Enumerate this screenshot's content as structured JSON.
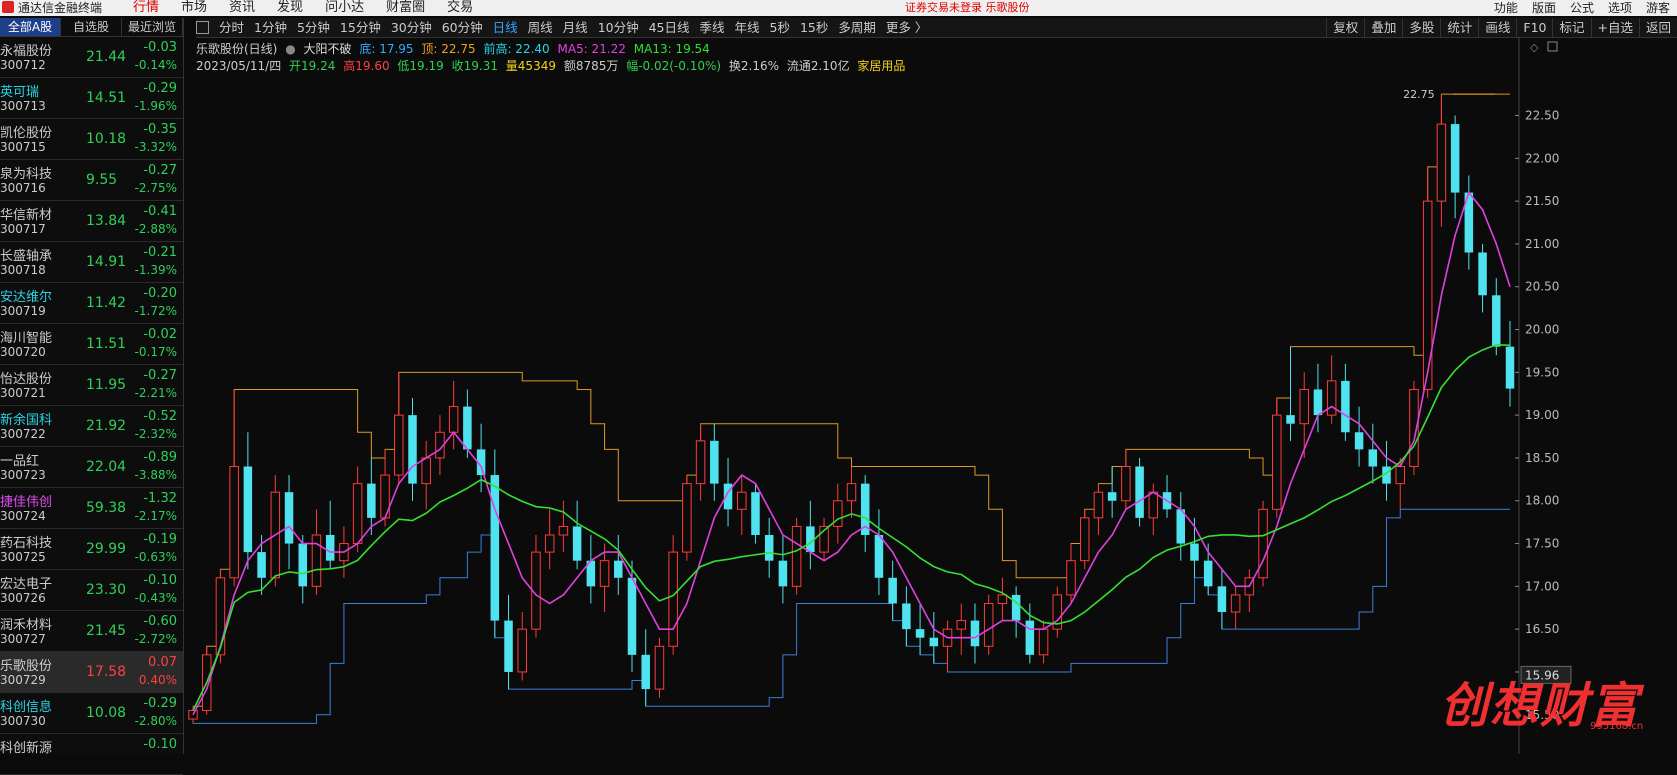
{
  "topbar": {
    "app_name": "通达信金融终端",
    "menu": [
      "行情",
      "市场",
      "资讯",
      "发现",
      "问小达",
      "财富圈",
      "交易"
    ],
    "notice": "证券交易未登录  乐歌股份",
    "right": [
      "功能",
      "版面",
      "公式",
      "选项",
      "游客"
    ]
  },
  "sidebar": {
    "tabs": [
      "全部A股",
      "自选股",
      "最近浏览"
    ],
    "stocks": [
      {
        "name": "永福股份",
        "code": "300712",
        "price": "21.44",
        "change": "-0.03",
        "pct": "-0.14%",
        "color": "normal"
      },
      {
        "name": "英可瑞",
        "code": "300713",
        "price": "14.51",
        "change": "-0.29",
        "pct": "-1.96%",
        "color": "cyan"
      },
      {
        "name": "凯伦股份",
        "code": "300715",
        "price": "10.18",
        "change": "-0.35",
        "pct": "-3.32%",
        "color": "normal"
      },
      {
        "name": "泉为科技",
        "code": "300716",
        "price": "9.55",
        "change": "-0.27",
        "pct": "-2.75%",
        "color": "normal"
      },
      {
        "name": "华信新材",
        "code": "300717",
        "price": "13.84",
        "change": "-0.41",
        "pct": "-2.88%",
        "color": "normal"
      },
      {
        "name": "长盛轴承",
        "code": "300718",
        "price": "14.91",
        "change": "-0.21",
        "pct": "-1.39%",
        "color": "normal"
      },
      {
        "name": "安达维尔",
        "code": "300719",
        "price": "11.42",
        "change": "-0.20",
        "pct": "-1.72%",
        "color": "cyan"
      },
      {
        "name": "海川智能",
        "code": "300720",
        "price": "11.51",
        "change": "-0.02",
        "pct": "-0.17%",
        "color": "normal"
      },
      {
        "name": "怡达股份",
        "code": "300721",
        "price": "11.95",
        "change": "-0.27",
        "pct": "-2.21%",
        "color": "normal"
      },
      {
        "name": "新余国科",
        "code": "300722",
        "price": "21.92",
        "change": "-0.52",
        "pct": "-2.32%",
        "color": "cyan"
      },
      {
        "name": "一品红",
        "code": "300723",
        "price": "22.04",
        "change": "-0.89",
        "pct": "-3.88%",
        "color": "normal"
      },
      {
        "name": "捷佳伟创",
        "code": "300724",
        "price": "59.38",
        "change": "-1.32",
        "pct": "-2.17%",
        "color": "mag"
      },
      {
        "name": "药石科技",
        "code": "300725",
        "price": "29.99",
        "change": "-0.19",
        "pct": "-0.63%",
        "color": "normal"
      },
      {
        "name": "宏达电子",
        "code": "300726",
        "price": "23.30",
        "change": "-0.10",
        "pct": "-0.43%",
        "color": "normal"
      },
      {
        "name": "润禾材料",
        "code": "300727",
        "price": "21.45",
        "change": "-0.60",
        "pct": "-2.72%",
        "color": "normal"
      },
      {
        "name": "乐歌股份",
        "code": "300729",
        "price": "17.58",
        "change": "0.07",
        "pct": "0.40%",
        "color": "normal",
        "selected": true
      },
      {
        "name": "科创信息",
        "code": "300730",
        "price": "10.08",
        "change": "-0.29",
        "pct": "-2.80%",
        "color": "cyan"
      },
      {
        "name": "科创新源",
        "code": "",
        "price": "",
        "change": "-0.10",
        "pct": "",
        "color": "normal"
      }
    ]
  },
  "timeframes": [
    "分时",
    "1分钟",
    "5分钟",
    "15分钟",
    "30分钟",
    "60分钟",
    "日线",
    "周线",
    "月线",
    "10分钟",
    "45日线",
    "季线",
    "年线",
    "5秒",
    "15秒",
    "多周期",
    "更多 〉"
  ],
  "active_timeframe": "日线",
  "chart_tools": [
    "复权",
    "叠加",
    "多股",
    "统计",
    "画线",
    "F10",
    "标记",
    "+自选",
    "返回"
  ],
  "info": {
    "title": "乐歌股份(日线)",
    "indicator": "大阳不破",
    "bottom_label": "底: 17.95",
    "top_label": "顶: 22.75",
    "prev_high": "前高: 22.40",
    "ma5": "MA5: 21.22",
    "ma13": "MA13: 19.54",
    "date": "2023/05/11/四",
    "open": "开19.24",
    "high": "高19.60",
    "low": "低19.19",
    "close": "收19.31",
    "volume": "量45349",
    "amount": "额8785万",
    "amplitude": "幅-0.02(-0.10%)",
    "turnover": "换2.16%",
    "float_shares": "流通2.10亿",
    "industry": "家居用品"
  },
  "annotations": {
    "top_price": "22.75",
    "current_price": "15.96"
  },
  "watermark": {
    "text": "创想财富",
    "url": "995168.cn"
  },
  "chart_data": {
    "type": "candlestick",
    "ylim": [
      15.1,
      22.95
    ],
    "yticks": [
      15.5,
      16.0,
      16.5,
      17.0,
      17.5,
      18.0,
      18.5,
      19.0,
      19.5,
      20.0,
      20.5,
      21.0,
      21.5,
      22.0,
      22.5
    ],
    "candles": [
      [
        15.45,
        15.6,
        15.4,
        15.55
      ],
      [
        15.55,
        16.3,
        15.5,
        16.2
      ],
      [
        16.2,
        17.2,
        16.1,
        17.1
      ],
      [
        17.1,
        19.3,
        17.0,
        18.4
      ],
      [
        18.4,
        18.8,
        17.2,
        17.4
      ],
      [
        17.4,
        17.6,
        16.9,
        17.1
      ],
      [
        17.1,
        18.3,
        17.0,
        18.1
      ],
      [
        18.1,
        18.3,
        17.2,
        17.5
      ],
      [
        17.5,
        17.6,
        16.8,
        17.0
      ],
      [
        17.0,
        17.9,
        16.9,
        17.6
      ],
      [
        17.6,
        18.0,
        17.2,
        17.3
      ],
      [
        17.3,
        17.7,
        17.1,
        17.5
      ],
      [
        17.5,
        18.4,
        17.4,
        18.2
      ],
      [
        18.2,
        18.5,
        17.6,
        17.8
      ],
      [
        17.8,
        18.6,
        17.7,
        18.3
      ],
      [
        18.3,
        19.5,
        18.2,
        19.0
      ],
      [
        19.0,
        19.2,
        18.0,
        18.2
      ],
      [
        18.2,
        18.7,
        17.9,
        18.5
      ],
      [
        18.5,
        19.0,
        18.3,
        18.8
      ],
      [
        18.8,
        19.4,
        18.6,
        19.1
      ],
      [
        19.1,
        19.3,
        18.5,
        18.6
      ],
      [
        18.6,
        18.9,
        18.1,
        18.3
      ],
      [
        18.3,
        18.6,
        16.4,
        16.6
      ],
      [
        16.6,
        16.9,
        15.8,
        16.0
      ],
      [
        16.0,
        16.7,
        15.9,
        16.5
      ],
      [
        16.5,
        17.6,
        16.4,
        17.4
      ],
      [
        17.4,
        17.9,
        17.2,
        17.6
      ],
      [
        17.6,
        18.0,
        17.4,
        17.7
      ],
      [
        17.7,
        18.0,
        17.2,
        17.3
      ],
      [
        17.3,
        17.6,
        16.8,
        17.0
      ],
      [
        17.0,
        17.5,
        16.7,
        17.3
      ],
      [
        17.3,
        17.6,
        16.9,
        17.1
      ],
      [
        17.1,
        17.3,
        16.0,
        16.2
      ],
      [
        16.2,
        16.5,
        15.6,
        15.8
      ],
      [
        15.8,
        16.4,
        15.7,
        16.3
      ],
      [
        16.3,
        17.6,
        16.2,
        17.4
      ],
      [
        17.4,
        18.3,
        17.3,
        18.2
      ],
      [
        18.2,
        18.9,
        18.0,
        18.7
      ],
      [
        18.7,
        18.9,
        18.0,
        18.2
      ],
      [
        18.2,
        18.5,
        17.7,
        17.9
      ],
      [
        17.9,
        18.3,
        17.6,
        18.1
      ],
      [
        18.1,
        18.2,
        17.5,
        17.6
      ],
      [
        17.6,
        17.8,
        17.1,
        17.3
      ],
      [
        17.3,
        17.6,
        16.8,
        17.0
      ],
      [
        17.0,
        17.8,
        16.9,
        17.7
      ],
      [
        17.7,
        18.0,
        17.2,
        17.4
      ],
      [
        17.4,
        17.8,
        17.3,
        17.7
      ],
      [
        17.7,
        18.2,
        17.5,
        18.0
      ],
      [
        18.0,
        18.4,
        17.8,
        18.2
      ],
      [
        18.2,
        18.3,
        17.4,
        17.6
      ],
      [
        17.6,
        17.9,
        16.9,
        17.1
      ],
      [
        17.1,
        17.3,
        16.6,
        16.8
      ],
      [
        16.8,
        17.0,
        16.3,
        16.5
      ],
      [
        16.5,
        16.8,
        16.2,
        16.4
      ],
      [
        16.4,
        16.7,
        16.1,
        16.3
      ],
      [
        16.3,
        16.6,
        16.0,
        16.5
      ],
      [
        16.5,
        16.8,
        16.2,
        16.6
      ],
      [
        16.6,
        16.8,
        16.1,
        16.3
      ],
      [
        16.3,
        16.9,
        16.2,
        16.8
      ],
      [
        16.8,
        17.1,
        16.6,
        16.9
      ],
      [
        16.9,
        17.0,
        16.4,
        16.6
      ],
      [
        16.6,
        16.8,
        16.1,
        16.2
      ],
      [
        16.2,
        16.6,
        16.1,
        16.5
      ],
      [
        16.5,
        17.0,
        16.4,
        16.9
      ],
      [
        16.9,
        17.5,
        16.8,
        17.3
      ],
      [
        17.3,
        17.9,
        17.2,
        17.8
      ],
      [
        17.8,
        18.2,
        17.6,
        18.1
      ],
      [
        18.1,
        18.4,
        17.8,
        18.0
      ],
      [
        18.0,
        18.6,
        17.9,
        18.4
      ],
      [
        18.4,
        18.5,
        17.7,
        17.8
      ],
      [
        17.8,
        18.2,
        17.6,
        18.1
      ],
      [
        18.1,
        18.3,
        17.8,
        17.9
      ],
      [
        17.9,
        18.1,
        17.3,
        17.5
      ],
      [
        17.5,
        17.8,
        17.1,
        17.3
      ],
      [
        17.3,
        17.5,
        16.9,
        17.0
      ],
      [
        17.0,
        17.2,
        16.5,
        16.7
      ],
      [
        16.7,
        17.0,
        16.5,
        16.9
      ],
      [
        16.9,
        17.2,
        16.7,
        17.1
      ],
      [
        17.1,
        18.0,
        17.0,
        17.9
      ],
      [
        17.9,
        19.2,
        17.8,
        19.0
      ],
      [
        19.0,
        19.8,
        18.7,
        18.9
      ],
      [
        18.9,
        19.5,
        18.5,
        19.3
      ],
      [
        19.3,
        19.6,
        18.8,
        19.0
      ],
      [
        19.0,
        19.7,
        18.9,
        19.4
      ],
      [
        19.4,
        19.6,
        18.7,
        18.8
      ],
      [
        18.8,
        19.1,
        18.4,
        18.6
      ],
      [
        18.6,
        18.9,
        18.2,
        18.4
      ],
      [
        18.4,
        18.7,
        18.0,
        18.2
      ],
      [
        18.2,
        18.5,
        17.9,
        18.4
      ],
      [
        18.4,
        19.4,
        18.3,
        19.3
      ],
      [
        19.3,
        21.9,
        19.2,
        21.5
      ],
      [
        21.5,
        22.75,
        21.2,
        22.4
      ],
      [
        22.4,
        22.5,
        21.3,
        21.6
      ],
      [
        21.6,
        21.8,
        20.7,
        20.9
      ],
      [
        20.9,
        21.0,
        20.2,
        20.4
      ],
      [
        20.4,
        20.6,
        19.7,
        19.8
      ],
      [
        19.8,
        20.1,
        19.1,
        19.31
      ]
    ],
    "ma5": [
      15.5,
      15.8,
      16.3,
      16.9,
      17.3,
      17.5,
      17.6,
      17.7,
      17.5,
      17.5,
      17.4,
      17.4,
      17.5,
      17.7,
      17.8,
      18.2,
      18.4,
      18.5,
      18.6,
      18.8,
      18.6,
      18.4,
      17.9,
      17.5,
      17.1,
      16.9,
      16.8,
      16.9,
      17.1,
      17.3,
      17.4,
      17.4,
      17.1,
      16.8,
      16.5,
      16.5,
      16.8,
      17.3,
      17.8,
      18.1,
      18.3,
      18.2,
      17.9,
      17.6,
      17.5,
      17.4,
      17.3,
      17.4,
      17.6,
      17.7,
      17.6,
      17.4,
      17.1,
      16.8,
      16.5,
      16.4,
      16.4,
      16.4,
      16.5,
      16.6,
      16.6,
      16.5,
      16.5,
      16.6,
      16.8,
      17.1,
      17.4,
      17.6,
      17.9,
      18.0,
      18.1,
      18.0,
      17.9,
      17.7,
      17.4,
      17.2,
      17.0,
      17.0,
      17.3,
      17.7,
      18.2,
      18.6,
      19.0,
      19.1,
      19.0,
      18.9,
      18.7,
      18.5,
      18.4,
      18.7,
      19.5,
      20.4,
      21.1,
      21.6,
      21.4,
      21.0,
      20.5
    ]
  }
}
